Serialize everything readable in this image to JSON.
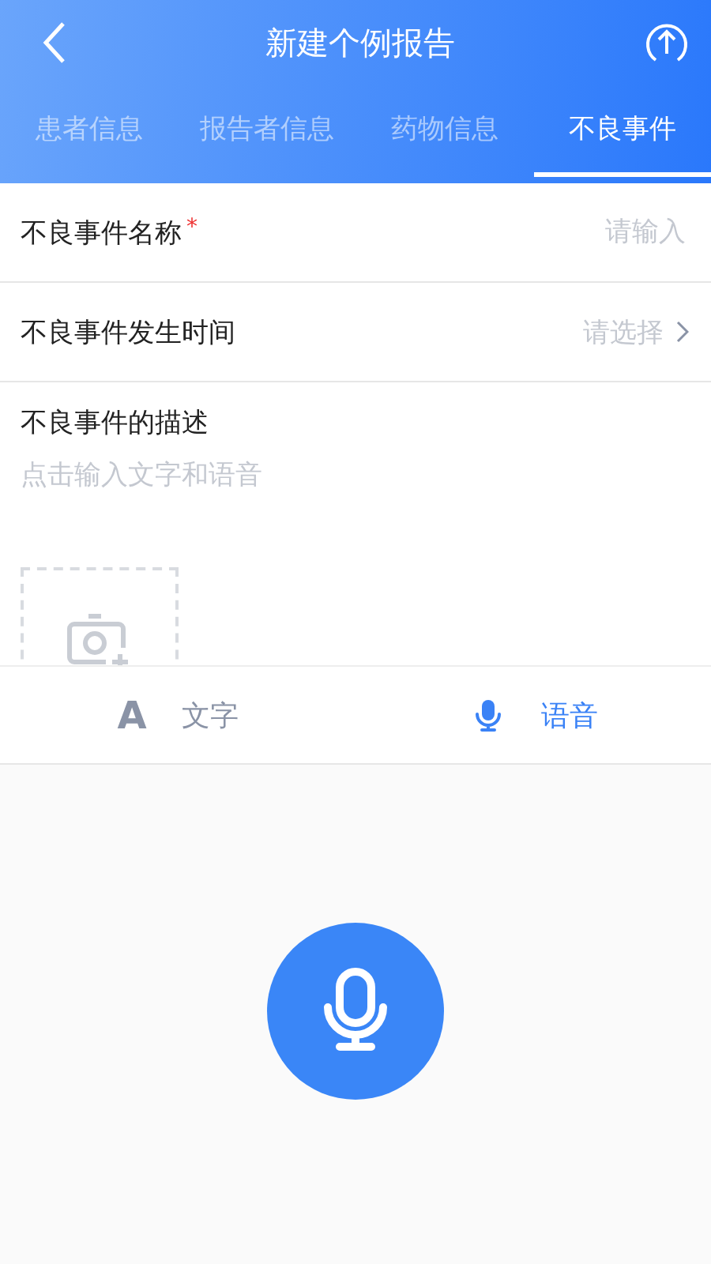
{
  "header": {
    "title": "新建个例报告"
  },
  "tabs": [
    {
      "label": "患者信息",
      "selected": false
    },
    {
      "label": "报告者信息",
      "selected": false
    },
    {
      "label": "药物信息",
      "selected": false
    },
    {
      "label": "不良事件",
      "selected": true
    }
  ],
  "fields": [
    {
      "kind": "input",
      "label": "不良事件名称",
      "required_mark": "*",
      "placeholder": "请输入"
    },
    {
      "kind": "select",
      "label": "不良事件发生时间",
      "placeholder": "请选择"
    }
  ],
  "description": {
    "label": "不良事件的描述",
    "placeholder": "点击输入文字和语音"
  },
  "input_modes": [
    {
      "kind": "text",
      "glyph": "A",
      "label": "文字",
      "selected": false
    },
    {
      "kind": "voice",
      "label": "语音",
      "selected": true
    }
  ]
}
